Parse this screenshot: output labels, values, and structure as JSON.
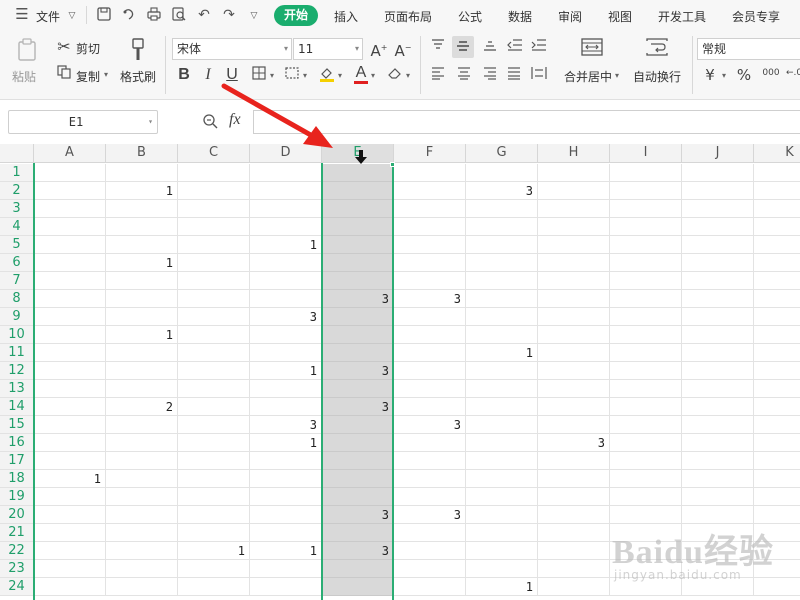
{
  "menu": {
    "file": "文件",
    "tabs": [
      "开始",
      "插入",
      "页面布局",
      "公式",
      "数据",
      "审阅",
      "视图",
      "开发工具",
      "会员专享"
    ]
  },
  "ribbon": {
    "paste": "粘贴",
    "cut": "剪切",
    "copy": "复制",
    "format_painter": "格式刷",
    "font_name": "宋体",
    "font_size": "11",
    "merge_center": "合并居中",
    "wrap_text": "自动换行",
    "number_format": "常规",
    "currency_symbol": "¥",
    "percent_symbol": "%",
    "thousands_symbol": "000"
  },
  "formula_bar": {
    "name_box": "E1",
    "fx": "fx",
    "formula": ""
  },
  "grid": {
    "columns": [
      "A",
      "B",
      "C",
      "D",
      "E",
      "F",
      "G",
      "H",
      "I",
      "J",
      "K"
    ],
    "rows": [
      "1",
      "2",
      "3",
      "4",
      "5",
      "6",
      "7",
      "8",
      "9",
      "10",
      "11",
      "12",
      "13",
      "14",
      "15",
      "16",
      "17",
      "18",
      "19",
      "20",
      "21",
      "22",
      "23",
      "24"
    ],
    "selected_column": "E",
    "cells": [
      {
        "row": 2,
        "col": "B",
        "value": "1"
      },
      {
        "row": 2,
        "col": "G",
        "value": "3"
      },
      {
        "row": 5,
        "col": "D",
        "value": "1"
      },
      {
        "row": 6,
        "col": "B",
        "value": "1"
      },
      {
        "row": 8,
        "col": "E",
        "value": "3"
      },
      {
        "row": 8,
        "col": "F",
        "value": "3"
      },
      {
        "row": 9,
        "col": "D",
        "value": "3"
      },
      {
        "row": 10,
        "col": "B",
        "value": "1"
      },
      {
        "row": 11,
        "col": "G",
        "value": "1"
      },
      {
        "row": 12,
        "col": "D",
        "value": "1"
      },
      {
        "row": 12,
        "col": "E",
        "value": "3"
      },
      {
        "row": 14,
        "col": "B",
        "value": "2"
      },
      {
        "row": 14,
        "col": "E",
        "value": "3"
      },
      {
        "row": 15,
        "col": "D",
        "value": "3"
      },
      {
        "row": 15,
        "col": "F",
        "value": "3"
      },
      {
        "row": 16,
        "col": "D",
        "value": "1"
      },
      {
        "row": 16,
        "col": "H",
        "value": "3"
      },
      {
        "row": 18,
        "col": "A",
        "value": "1"
      },
      {
        "row": 20,
        "col": "E",
        "value": "3"
      },
      {
        "row": 20,
        "col": "F",
        "value": "3"
      },
      {
        "row": 22,
        "col": "C",
        "value": "1"
      },
      {
        "row": 22,
        "col": "D",
        "value": "1"
      },
      {
        "row": 22,
        "col": "E",
        "value": "3"
      },
      {
        "row": 24,
        "col": "G",
        "value": "1"
      }
    ]
  },
  "watermark": {
    "logo": "Baidu经验",
    "url": "jingyan.baidu.com"
  },
  "colors": {
    "accent": "#1aad6e",
    "selection_border": "#2bad74",
    "selection_fill": "#d9d9d9",
    "arrow": "#e8231d"
  }
}
